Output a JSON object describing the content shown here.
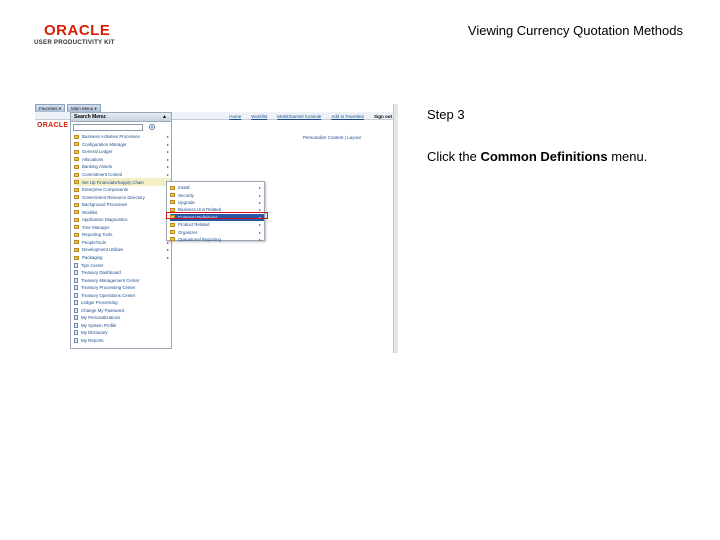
{
  "logo": {
    "word": "ORACLE",
    "subtitle": "USER PRODUCTIVITY KIT"
  },
  "doc_title": "Viewing Currency Quotation Methods",
  "step": {
    "label": "Step 3",
    "instruction_prefix": "Click the ",
    "instruction_target": "Common Definitions",
    "instruction_suffix": " menu."
  },
  "screenshot": {
    "nav_tabs": [
      "Favorites",
      "Main Menu"
    ],
    "top_links": [
      "Home",
      "Worklist",
      "MultiChannel Console",
      "Add to Favorites",
      "Sign out"
    ],
    "brand_mini": "ORACLE",
    "personalize": "Personalize Content | Layout",
    "menu_header": "Search Menu:",
    "menu_items": [
      {
        "label": "Business Activities Processes",
        "type": "folder",
        "arrow": true
      },
      {
        "label": "Configuration Manager",
        "type": "folder",
        "arrow": true
      },
      {
        "label": "General Ledger",
        "type": "folder",
        "arrow": true
      },
      {
        "label": "Allocations",
        "type": "folder",
        "arrow": true
      },
      {
        "label": "Banking Assets",
        "type": "folder",
        "arrow": true
      },
      {
        "label": "Commitment Control",
        "type": "folder",
        "arrow": true
      },
      {
        "label": "Set Up Financials/Supply Chain",
        "type": "folder",
        "arrow": true,
        "active": true
      },
      {
        "label": "Enterprise Components",
        "type": "folder",
        "arrow": true
      },
      {
        "label": "Government Resource Directory",
        "type": "folder",
        "arrow": true
      },
      {
        "label": "Background Processes",
        "type": "folder",
        "arrow": true
      },
      {
        "label": "Worklist",
        "type": "folder",
        "arrow": true
      },
      {
        "label": "Application Diagnostics",
        "type": "folder",
        "arrow": true
      },
      {
        "label": "Tree Manager",
        "type": "folder",
        "arrow": true
      },
      {
        "label": "Reporting Tools",
        "type": "folder",
        "arrow": true
      },
      {
        "label": "PeopleTools",
        "type": "folder",
        "arrow": true
      },
      {
        "label": "Development Utilities",
        "type": "folder",
        "arrow": true
      },
      {
        "label": "Packaging",
        "type": "folder",
        "arrow": true
      },
      {
        "label": "Tips Center",
        "type": "doc",
        "arrow": false
      },
      {
        "label": "Treasury Dashboard",
        "type": "doc",
        "arrow": false
      },
      {
        "label": "Treasury Management Center",
        "type": "doc",
        "arrow": false
      },
      {
        "label": "Treasury Processing Center",
        "type": "doc",
        "arrow": false
      },
      {
        "label": "Treasury Operations Center",
        "type": "doc",
        "arrow": false
      },
      {
        "label": "Ledger Processing",
        "type": "doc",
        "arrow": false
      },
      {
        "label": "Change My Password",
        "type": "doc",
        "arrow": false
      },
      {
        "label": "My Personalizations",
        "type": "doc",
        "arrow": false
      },
      {
        "label": "My System Profile",
        "type": "doc",
        "arrow": false
      },
      {
        "label": "My Dictionary",
        "type": "doc",
        "arrow": false
      },
      {
        "label": "My Reports",
        "type": "doc",
        "arrow": false
      }
    ],
    "submenu_items": [
      {
        "label": "Install",
        "highlighted": false
      },
      {
        "label": "Security",
        "highlighted": false
      },
      {
        "label": "Upgrade",
        "highlighted": false
      },
      {
        "label": "Business Unit Related",
        "highlighted": false
      },
      {
        "label": "Common Definitions",
        "highlighted": true
      },
      {
        "label": "Product Related",
        "highlighted": false
      },
      {
        "label": "Organizer",
        "highlighted": false
      },
      {
        "label": "Operational Reporting",
        "highlighted": false
      }
    ],
    "colors": {
      "highlight_border": "#d0101a",
      "selected_bg": "#2a57a5",
      "link": "#1a4b8c"
    }
  }
}
